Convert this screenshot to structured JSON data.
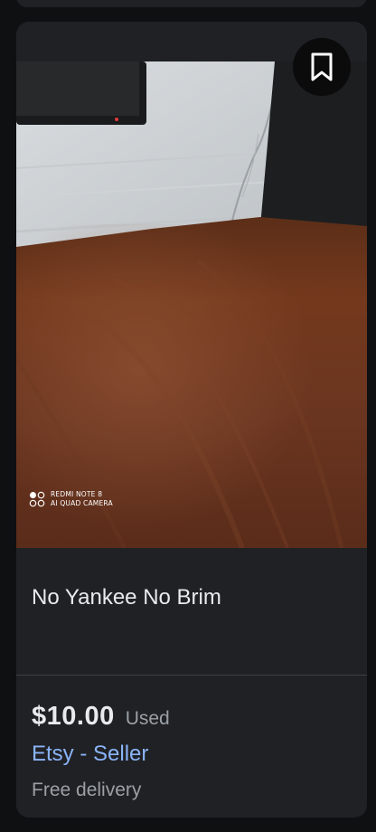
{
  "listing": {
    "image_watermark": {
      "line1": "REDMI NOTE 8",
      "line2": "AI QUAD CAMERA"
    },
    "bookmark_icon": "bookmark-outline-icon",
    "title": "No Yankee No Brim",
    "price": "$10.00",
    "condition": "Used",
    "seller": "Etsy - Seller",
    "delivery": "Free delivery"
  },
  "colors": {
    "card_bg": "#202125",
    "page_bg": "#0f1012",
    "title_text": "#e8eaed",
    "secondary_text": "#9aa0a6",
    "link": "#8ab4f8"
  }
}
